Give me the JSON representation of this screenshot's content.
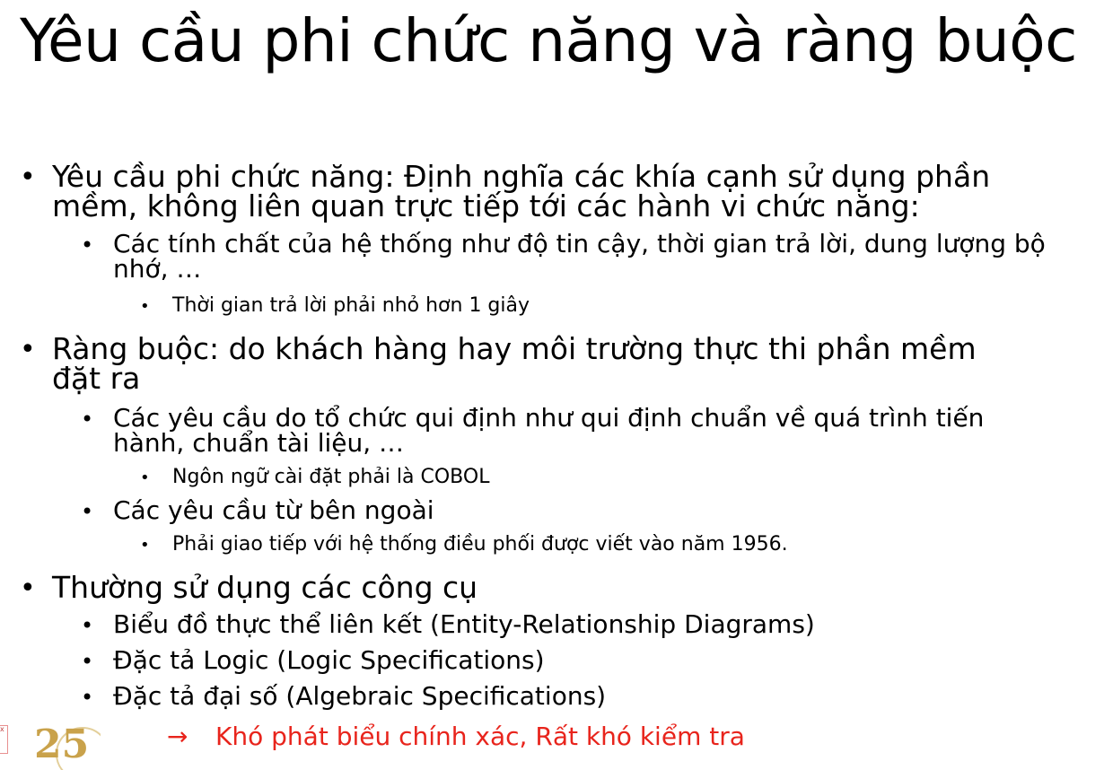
{
  "slide": {
    "title": "Yêu cầu phi chức năng và ràng buộc",
    "bullets": [
      {
        "text": "Yêu cầu phi chức năng: Định nghĩa các khía cạnh sử dụng phần mềm, không liên quan trực tiếp tới các hành vi chức năng:",
        "children": [
          {
            "text": "Các tính chất của hệ thống như độ tin cậy, thời gian trả lời, dung lượng bộ nhớ, …",
            "children": [
              {
                "text": "Thời gian trả lời phải nhỏ hơn 1 giây"
              }
            ]
          }
        ]
      },
      {
        "text": "Ràng buộc: do khách hàng hay môi trường thực thi phần mềm đặt ra",
        "children": [
          {
            "text": "Các yêu cầu do tổ chức qui định như qui định chuẩn về quá trình tiến hành, chuẩn tài liệu, …",
            "children": [
              {
                "text": "Ngôn ngữ cài đặt phải là COBOL"
              }
            ]
          },
          {
            "text": "Các yêu cầu từ bên ngoài",
            "children": [
              {
                "text": "Phải giao tiếp với hệ thống điều phối được viết vào năm 1956."
              }
            ]
          }
        ]
      },
      {
        "text": "Thường sử dụng các công cụ",
        "children": [
          {
            "text": "Biểu đồ thực thể liên kết (Entity-Relationship Diagrams)"
          },
          {
            "text": "Đặc tả Logic (Logic Specifications)"
          },
          {
            "text": "Đặc tả đại số (Algebraic Specifications)"
          }
        ]
      }
    ],
    "conclusion": {
      "arrow": "→",
      "text": "Khó phát biểu chính xác, Rất khó kiểm tra"
    },
    "logo": {
      "digits": "25",
      "mark": "x"
    },
    "bullet_glyph": "•",
    "colors": {
      "conclusion": "#e8241c",
      "logo": "#c9a24b"
    }
  }
}
